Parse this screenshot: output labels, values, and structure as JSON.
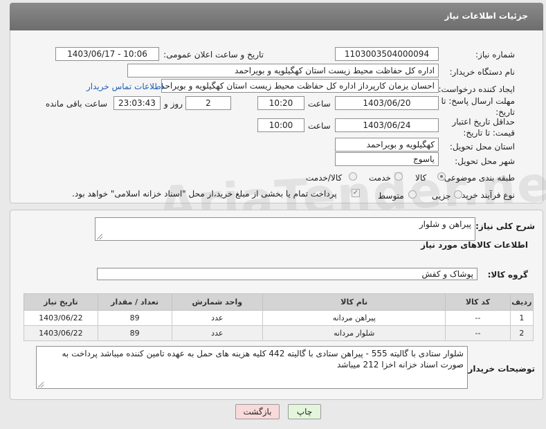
{
  "header": {
    "title": "جزئیات اطلاعات نیاز"
  },
  "form": {
    "need_number_label": "شماره نیاز:",
    "need_number": "1103003504000094",
    "announce_label": "تاریخ و ساعت اعلان عمومی:",
    "announce_value": "1403/06/17 - 10:06",
    "buyer_org_label": "نام دستگاه خریدار:",
    "buyer_org": "اداره کل حفاظت محیط زیست استان کهگیلویه و بویراحمد",
    "creator_label": "ایجاد کننده درخواست:",
    "creator": "احسان یزمان کارپرداز اداره کل حفاظت محیط زیست استان کهگیلویه و بویراحمد",
    "contact_link": "اطلاعات تماس خریدار",
    "deadline_label": "مهلت ارسال پاسخ: تا تاریخ:",
    "deadline_date": "1403/06/20",
    "time_label": "ساعت",
    "deadline_time": "10:20",
    "days_value": "2",
    "days_label": "روز و",
    "remaining_time": "23:03:43",
    "remaining_label": "ساعت باقی مانده",
    "validity_label": "حداقل تاریخ اعتبار قیمت: تا تاریخ:",
    "validity_date": "1403/06/24",
    "validity_time_label": "ساعت",
    "validity_time": "10:00",
    "province_label": "استان محل تحویل:",
    "province": "کهگیلویه و بویراحمد",
    "city_label": "شهر محل تحویل:",
    "city": "یاسوج",
    "category_label": "طبقه بندی موضوعی:",
    "category_options": [
      "کالا",
      "خدمت",
      "کالا/خدمت"
    ],
    "process_label": "نوع فرآیند خرید :",
    "process_options": [
      "جزیی",
      "متوسط"
    ],
    "process_note": "پرداخت تمام یا بخشی از مبلغ خرید،از محل \"اسناد خزانه اسلامی\" خواهد بود."
  },
  "summary": {
    "desc_label": "شرح کلی نیاز:",
    "desc_value": "پیراهن و شلوار",
    "goods_info_label": "اطلاعات کالاهای مورد نیاز",
    "group_label": "گروه کالا:",
    "group_value": "پوشاک و کفش"
  },
  "table": {
    "headers": [
      "ردیف",
      "کد کالا",
      "نام کالا",
      "واحد شمارش",
      "تعداد / مقدار",
      "تاریخ نیاز"
    ],
    "rows": [
      [
        "1",
        "--",
        "پیراهن مردانه",
        "عدد",
        "89",
        "1403/06/22"
      ],
      [
        "2",
        "--",
        "شلوار مردانه",
        "عدد",
        "89",
        "1403/06/22"
      ]
    ]
  },
  "notes": {
    "label": "توضیحات خریدار:",
    "text": "شلوار ستادی با گالیته  555 - پیراهن ستادی با گالیته  442 کلیه هزینه های حمل به عهده تامین کننده میباشد پرداخت به صورت اسناد خزانه اخزا 212 میباشد"
  },
  "buttons": {
    "print": "چاپ",
    "back": "بازگشت"
  },
  "watermark": "AriaTender.net",
  "colors": {
    "header": "#7a7a7a",
    "link": "#1e5fb4",
    "back_button": "#f9dada",
    "print_button": "#e3f6dc"
  }
}
